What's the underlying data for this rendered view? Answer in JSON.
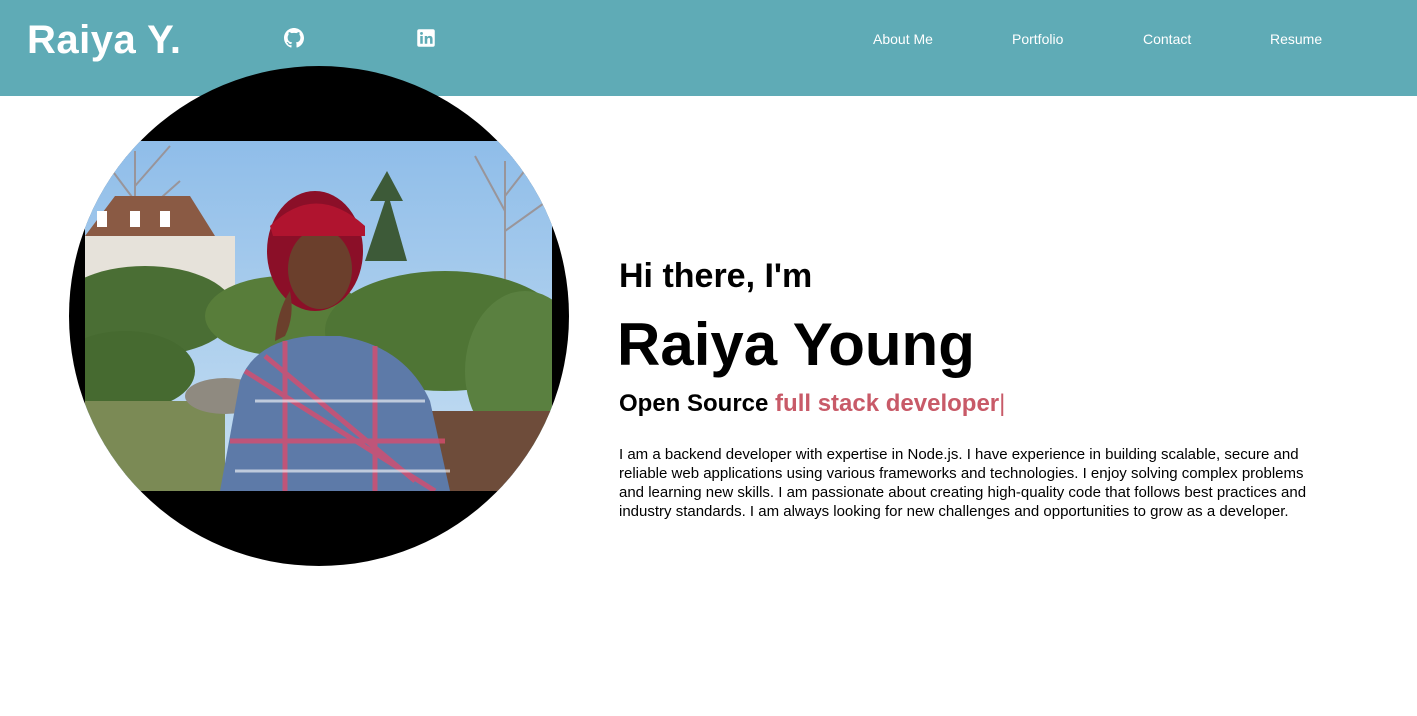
{
  "navbar": {
    "brand": "Raiya Y.",
    "background_color": "#5fabb6",
    "social_icons": [
      "github-icon",
      "linkedin-icon"
    ],
    "links": [
      {
        "label": "About Me"
      },
      {
        "label": "Portfolio"
      },
      {
        "label": "Contact"
      },
      {
        "label": "Resume"
      }
    ]
  },
  "hero": {
    "greeting": "Hi there, I'm",
    "name": "Raiya Young",
    "tagline_prefix": "Open Source",
    "tagline_typed": "full stack developer",
    "tagline_cursor": "|",
    "accent_color": "#c85a68",
    "bio": "I am a backend developer with expertise in Node.js. I have experience in building scalable, secure and reliable web applications using various frameworks and technologies. I enjoy solving complex problems and learning new skills. I am passionate about creating high-quality code that follows best practices and industry standards. I am always looking for new challenges and opportunities to grow as a developer."
  }
}
